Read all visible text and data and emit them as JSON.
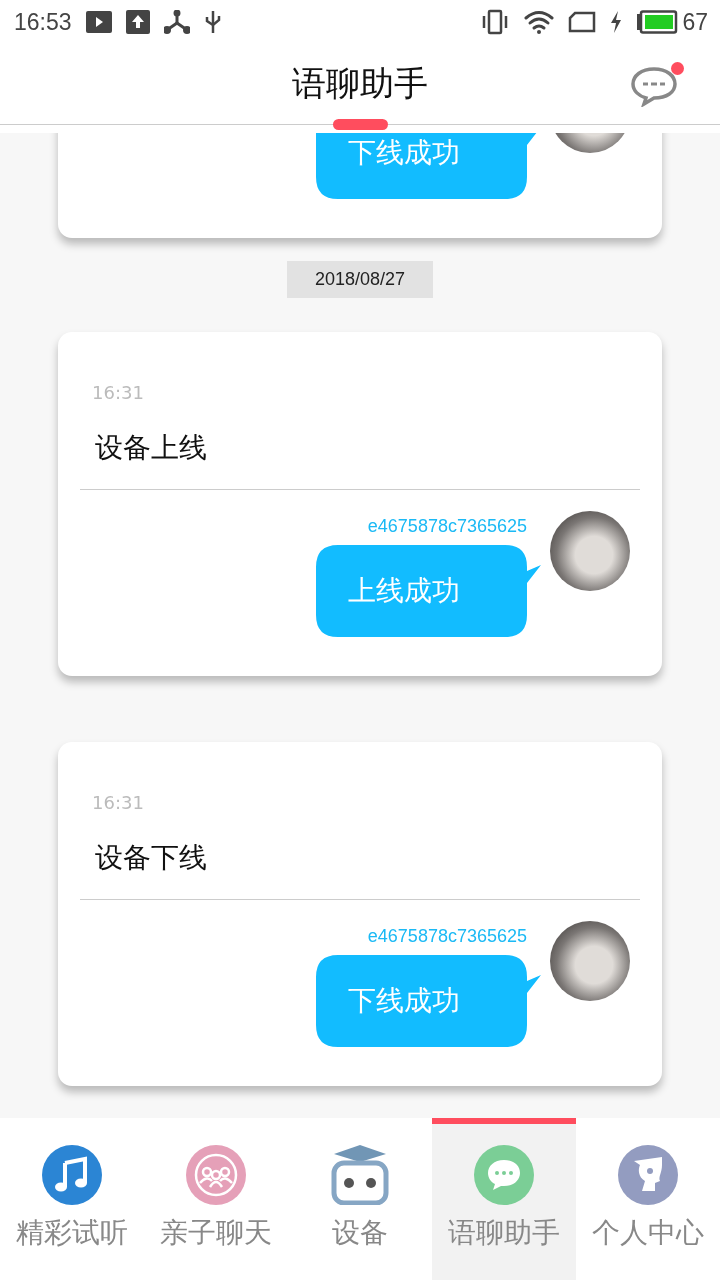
{
  "status_bar": {
    "time": "16:53",
    "battery": "67"
  },
  "header": {
    "title": "语聊助手",
    "message_unread": true
  },
  "feed": [
    {
      "kind": "card",
      "message": "下线成功",
      "clipped": true
    },
    {
      "kind": "date",
      "text": "2018/08/27"
    },
    {
      "kind": "card",
      "time": "16:31",
      "title": "设备上线",
      "device_id": "e4675878c7365625",
      "message": "上线成功",
      "clipped": false
    },
    {
      "kind": "card",
      "time": "16:31",
      "title": "设备下线",
      "device_id": "e4675878c7365625",
      "message": "下线成功",
      "clipped": false
    }
  ],
  "tabs": [
    {
      "kind": "music",
      "label": "精彩试听",
      "selected": false
    },
    {
      "kind": "family",
      "label": "亲子聊天",
      "selected": false
    },
    {
      "kind": "robot",
      "label": "设备",
      "selected": false
    },
    {
      "kind": "chat",
      "label": "语聊助手",
      "selected": true
    },
    {
      "kind": "person",
      "label": "个人中心",
      "selected": false
    }
  ]
}
